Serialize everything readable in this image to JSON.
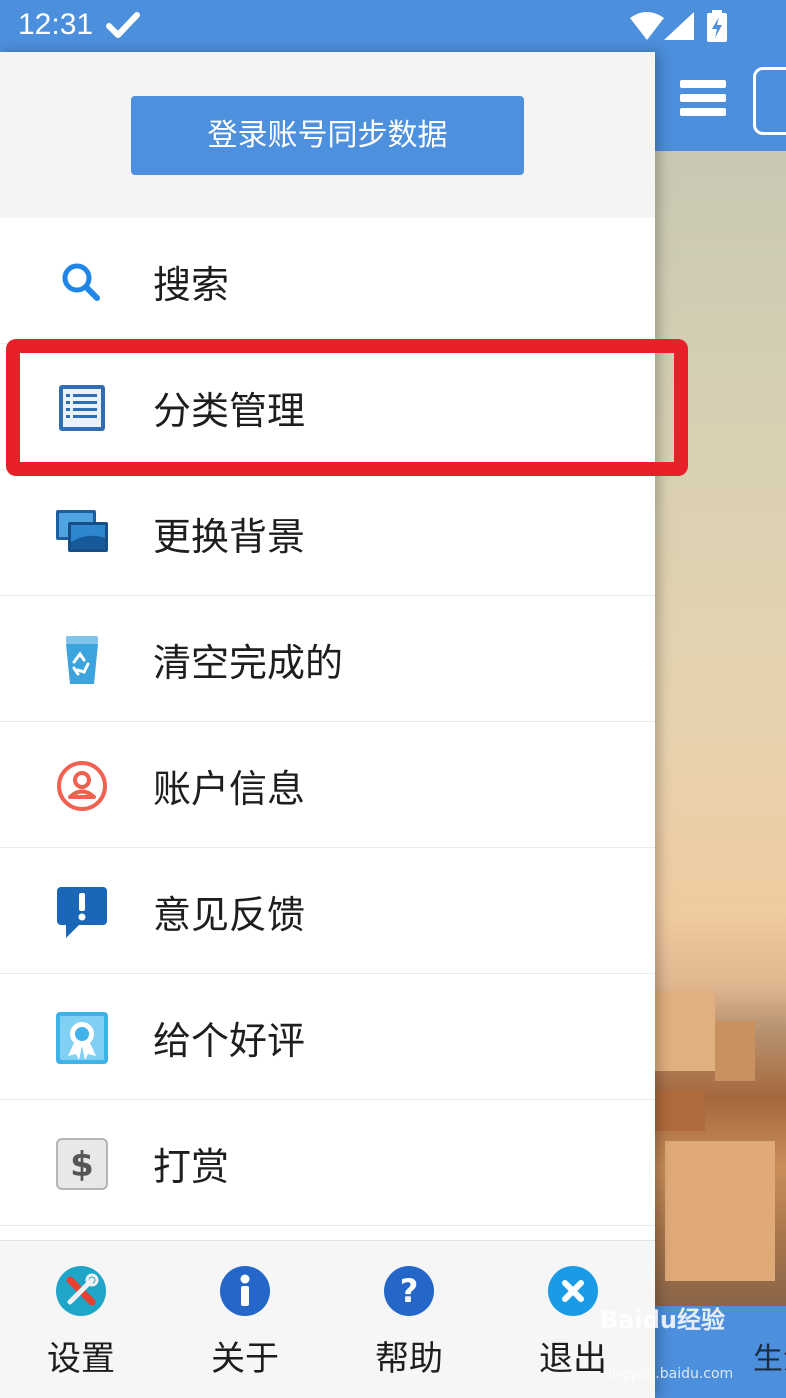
{
  "status_bar": {
    "time": "12:31",
    "icons": [
      "check-icon",
      "wifi-icon",
      "signal-icon",
      "battery-charging-icon"
    ],
    "color": "#4c8fdc"
  },
  "drawer": {
    "login_button": "登录账号同步数据",
    "menu": [
      {
        "label": "搜索",
        "icon": "search-icon"
      },
      {
        "label": "分类管理",
        "icon": "list-icon"
      },
      {
        "label": "更换背景",
        "icon": "background-icon"
      },
      {
        "label": "清空完成的",
        "icon": "recycle-bin-icon"
      },
      {
        "label": "账户信息",
        "icon": "user-icon"
      },
      {
        "label": "意见反馈",
        "icon": "feedback-icon"
      },
      {
        "label": "给个好评",
        "icon": "award-icon"
      },
      {
        "label": "打赏",
        "icon": "dollar-icon"
      }
    ],
    "bottom": [
      {
        "label": "设置",
        "icon": "settings-tools-icon"
      },
      {
        "label": "关于",
        "icon": "info-icon"
      },
      {
        "label": "帮助",
        "icon": "help-icon"
      },
      {
        "label": "退出",
        "icon": "exit-icon"
      }
    ]
  },
  "background_app": {
    "footer_text": "生活"
  },
  "watermark": {
    "text": "Baidu经验",
    "sub": "jingyan.baidu.com"
  },
  "colors": {
    "accent": "#4c8fdc",
    "highlight": "#e8202a"
  }
}
